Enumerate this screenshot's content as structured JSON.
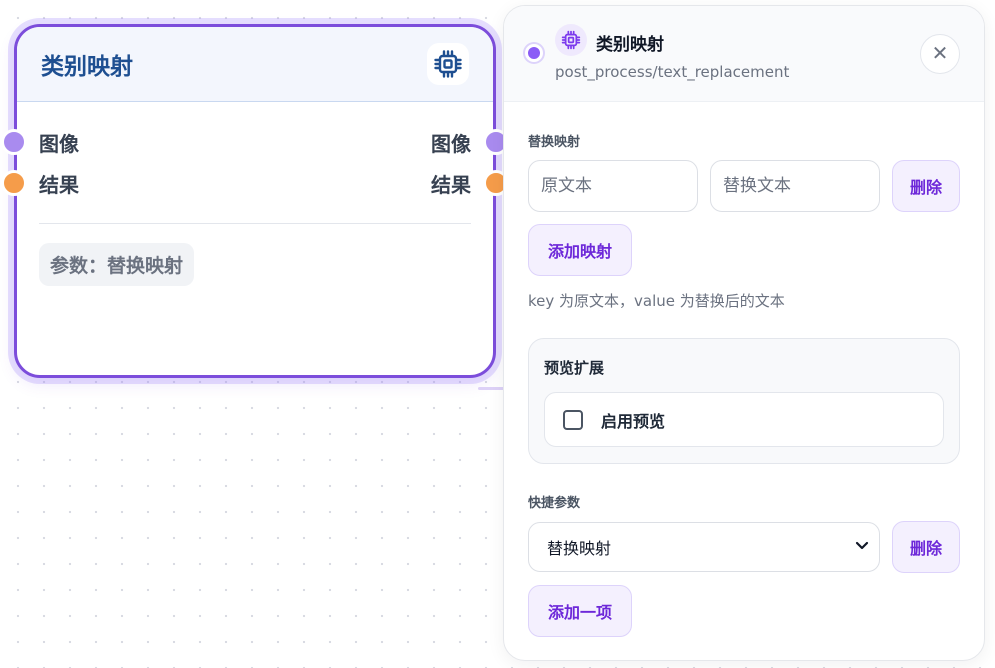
{
  "node": {
    "title": "类别映射",
    "icon": "chip-icon",
    "ports": {
      "inputs": [
        {
          "label": "图像",
          "color": "#a98bef"
        },
        {
          "label": "结果",
          "color": "#f59c4a"
        }
      ],
      "outputs": [
        {
          "label": "图像",
          "color": "#a98bef"
        },
        {
          "label": "结果",
          "color": "#f59c4a"
        }
      ]
    },
    "param_badge": "参数：替换映射",
    "border_color": "#7c4ddb"
  },
  "panel": {
    "title": "类别映射",
    "subtitle": "post_process/text_replacement",
    "icon": "chip-icon",
    "close_icon": "close-icon",
    "mapping": {
      "label": "替换映射",
      "source_placeholder": "原文本",
      "source_value": "",
      "target_placeholder": "替换文本",
      "target_value": "",
      "delete_label": "删除",
      "add_label": "添加映射",
      "helper": "key 为原文本，value 为替换后的文本"
    },
    "preview": {
      "title": "预览扩展",
      "option_label": "启用预览",
      "checked": false
    },
    "quick_params": {
      "label": "快捷参数",
      "selected": "替换映射",
      "delete_label": "删除",
      "add_label": "添加一项"
    }
  },
  "colors": {
    "accent": "#7c4ddb",
    "button_text": "#6d28d9",
    "title_blue": "#1e4f91"
  }
}
